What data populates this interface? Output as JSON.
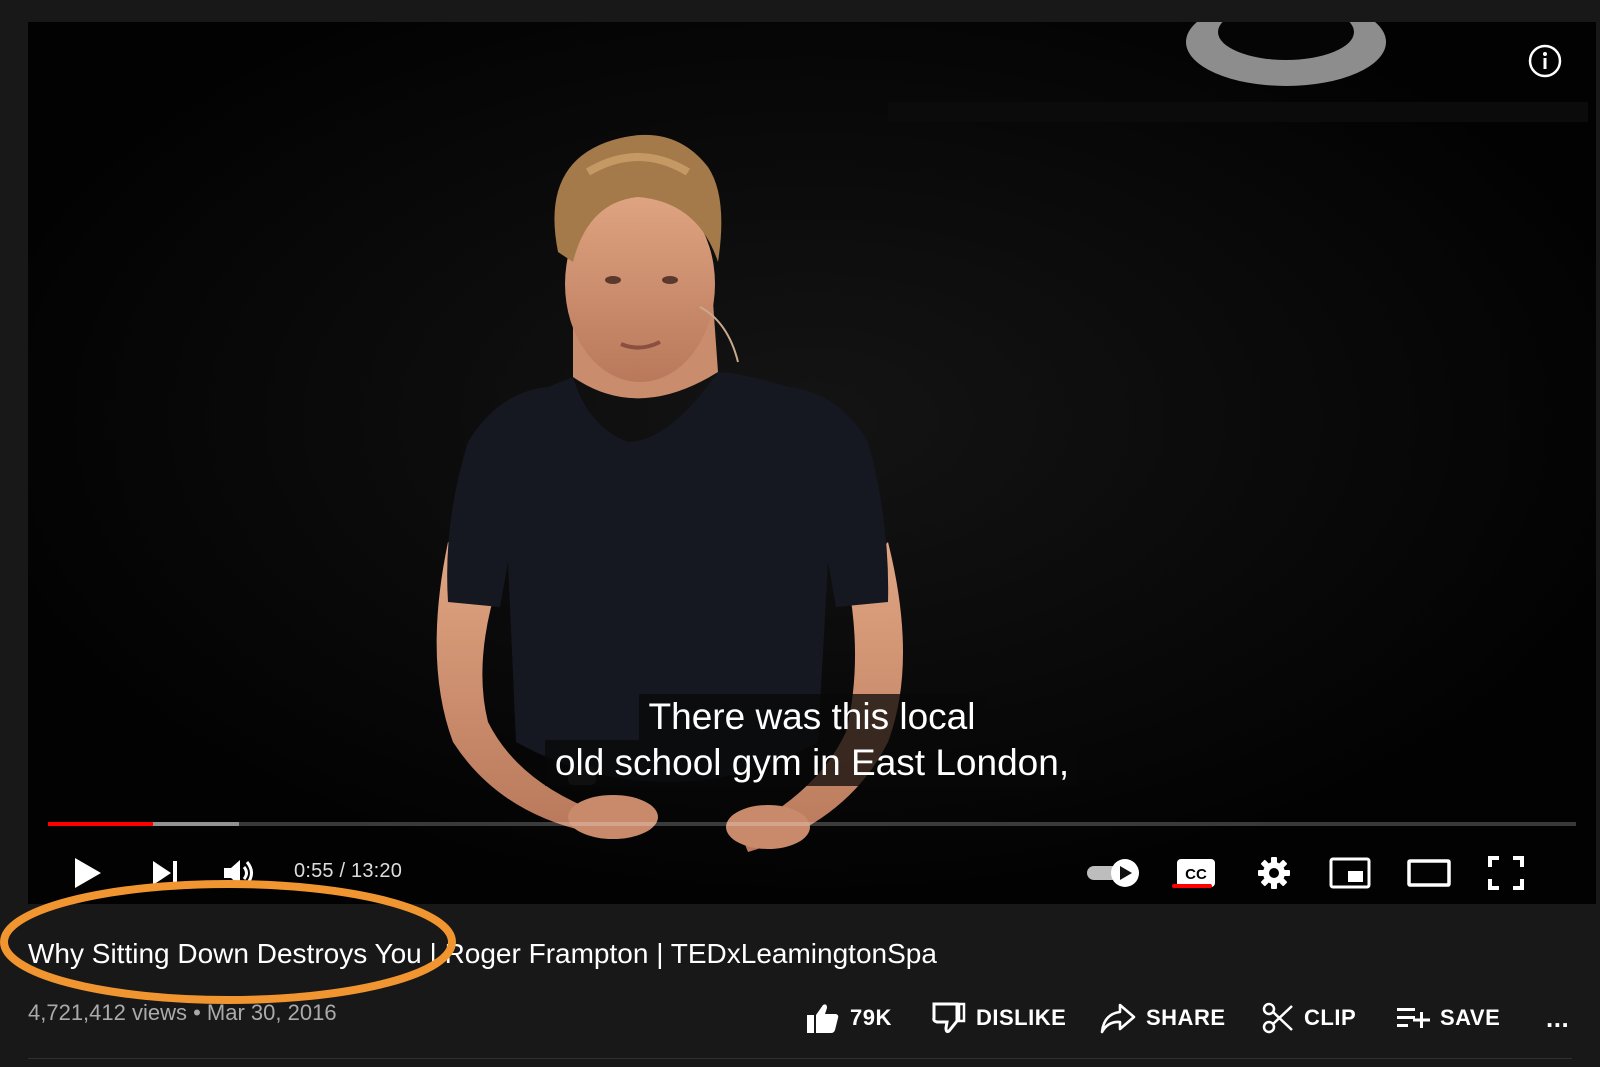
{
  "player": {
    "subtitle_lines": [
      "There was this local",
      "old school gym in East London,"
    ],
    "current_time": "0:55",
    "duration": "13:20",
    "time_display": "0:55 / 13:20",
    "played_fraction": 0.069,
    "buffered_fraction": 0.125,
    "autoplay": true,
    "captions_on": true,
    "colors": {
      "progress_played": "#ff0000",
      "progress_buffered": "#888888",
      "cc_active": "#ff0000"
    },
    "icons": [
      "info-icon",
      "play-icon",
      "next-icon",
      "volume-icon",
      "autoplay-toggle",
      "cc-icon",
      "settings-gear-icon",
      "miniplayer-icon",
      "theater-mode-icon",
      "fullscreen-icon"
    ]
  },
  "video": {
    "title": "Why Sitting Down Destroys You | Roger Frampton | TEDxLeamingtonSpa",
    "meta": "4,721,412 views • Mar 30, 2016"
  },
  "actions": {
    "like_count": "79K",
    "dislike_label": "DISLIKE",
    "share_label": "SHARE",
    "clip_label": "CLIP",
    "save_label": "SAVE",
    "more_label": "..."
  },
  "annotation": {
    "color": "#f0952f"
  }
}
